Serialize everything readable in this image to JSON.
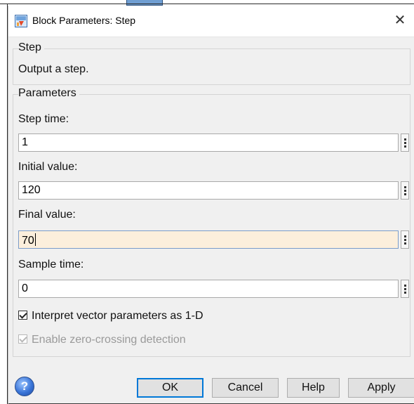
{
  "window": {
    "title": "Block Parameters: Step",
    "close_glyph": "✕",
    "icon": "simulink-block-icon"
  },
  "block_group": {
    "label": "Step",
    "description": "Output a step."
  },
  "parameters_group": {
    "label": "Parameters",
    "fields": [
      {
        "label": "Step time:",
        "value": "1",
        "focused": false
      },
      {
        "label": "Initial value:",
        "value": "120",
        "focused": false
      },
      {
        "label": "Final value:",
        "value": "70",
        "focused": true
      },
      {
        "label": "Sample time:",
        "value": "0",
        "focused": false
      }
    ],
    "checkboxes": [
      {
        "label": "Interpret vector parameters as 1-D",
        "checked": true,
        "enabled": true
      },
      {
        "label": "Enable zero-crossing detection",
        "checked": true,
        "enabled": false
      }
    ]
  },
  "footer": {
    "help_icon_glyph": "?",
    "ok_label": "OK",
    "cancel_label": "Cancel",
    "help_label": "Help",
    "apply_label": "Apply"
  },
  "colors": {
    "dialog_bg": "#f0f0f0",
    "focused_field_bg": "#fcefdc",
    "default_button_border": "#0078d7"
  }
}
